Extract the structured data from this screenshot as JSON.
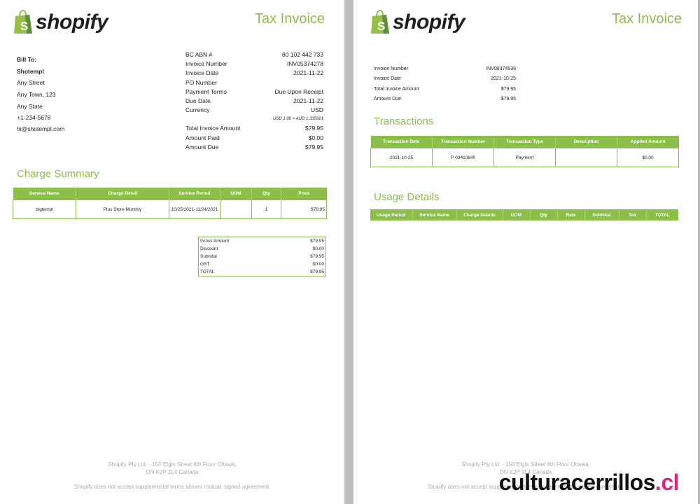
{
  "brand": {
    "wordmark": "shopify",
    "bag_letter": "S",
    "color": "#8cbf4a"
  },
  "page1": {
    "title": "Tax Invoice",
    "bill_to": {
      "heading": "Bill To:",
      "name": "Shotempl",
      "street": "Any Street",
      "town": "Any Town, 123",
      "state": "Any State",
      "phone": "+1-234-5678",
      "email": "hi@shotempl.com"
    },
    "details": {
      "abn_label": "BC ABN #",
      "abn": "80 102 442 733",
      "invoice_number_label": "Invoice Number",
      "invoice_number": "INV05374278",
      "invoice_date_label": "Invoice Date",
      "invoice_date": "2021-11-22",
      "po_number_label": "PO Number",
      "po_number": "",
      "payment_terms_label": "Payment Terms",
      "payment_terms": "Due Upon Receipt",
      "due_date_label": "Due Date",
      "due_date": "2021-11-22",
      "currency_label": "Currency",
      "currency": "USD",
      "exchange_rate": "USD 1.00 = AUD 1.335921",
      "total_label": "Total Invoice Amount",
      "total": "$79.95",
      "paid_label": "Amount Paid",
      "paid": "$0.00",
      "due_label": "Amount Due",
      "due": "$79.95"
    },
    "charge_summary": {
      "title": "Charge Summary",
      "headers": [
        "Service Name",
        "Charge Detail",
        "Service Period",
        "UOM",
        "Qty",
        "Price"
      ],
      "rows": [
        [
          "bigtempl",
          "Plus Store Monthly",
          "10/25/2021-11/24/2021",
          "",
          "1",
          "$79.95"
        ]
      ]
    },
    "totals": [
      [
        "Gross Amount",
        "$79.95"
      ],
      [
        "Discount",
        "$0.00"
      ],
      [
        "Subtotal",
        "$79.95"
      ],
      [
        "GST",
        "$0.00"
      ],
      [
        "TOTAL",
        "$79.95"
      ]
    ],
    "footer": {
      "address1": "Shopify Pty Ltd. · 150 Elgin Street 8th Floor Ottawa,",
      "address2": "ON K2P 1L4 Canada",
      "disclaimer": "Shopify does not accept supplemental terms absent mutual, signed agreement."
    }
  },
  "page2": {
    "title": "Tax Invoice",
    "summary": {
      "invoice_number_label": "Invoice Number",
      "invoice_number": "INV08374538",
      "invoice_date_label": "Invoice Date",
      "invoice_date": "2021-10-25",
      "total_label": "Total Invoice Amount",
      "total": "$79.95",
      "due_label": "Amount Due",
      "due": "$79.95"
    },
    "transactions": {
      "title": "Transactions",
      "headers": [
        "Transaction Date",
        "Transaction Number",
        "Transaction Type",
        "Description",
        "Applied Amount"
      ],
      "rows": [
        [
          "2021-10-25",
          "P-03410840",
          "Payment",
          "",
          "$0.00"
        ]
      ]
    },
    "usage": {
      "title": "Usage Details",
      "headers": [
        "Usage Period",
        "Service Name",
        "Charge Details",
        "UOM",
        "Qty",
        "Rate",
        "Subtotal",
        "Tax",
        "TOTAL"
      ]
    },
    "footer": {
      "address1": "Shopify Pty Ltd. · 150 Elgin Street 8th Floor Ottawa,",
      "address2": "ON K2P 1L4 Canada",
      "disclaimer": "Shopify does not accept supplemental terms absent mutual, signed agreement."
    }
  },
  "watermark": {
    "text": "culturacerrillos",
    "tld": ".cl"
  }
}
